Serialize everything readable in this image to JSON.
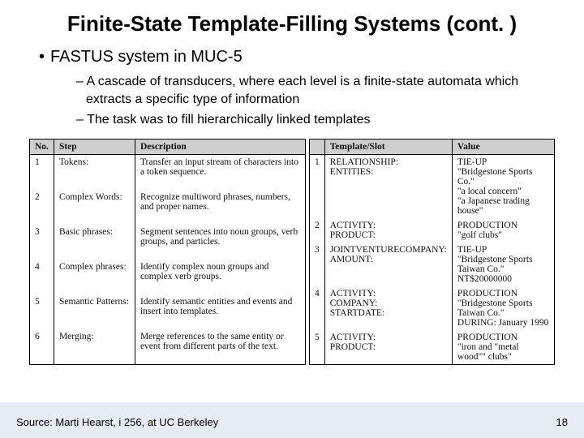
{
  "title": "Finite-State Template-Filling Systems (cont. )",
  "bullet_l1": "FASTUS system in MUC-5",
  "bullets_l2": [
    "A cascade of transducers, where each level is a finite-state automata which extracts a specific type of information",
    "The task was to fill hierarchically linked templates"
  ],
  "table_left": {
    "headers": [
      "No.",
      "Step",
      "Description"
    ],
    "rows": [
      [
        "1",
        "Tokens:",
        "Transfer an input stream of characters into a token sequence."
      ],
      [
        "2",
        "Complex Words:",
        "Recognize multiword phrases, numbers, and proper names."
      ],
      [
        "3",
        "Basic phrases:",
        "Segment sentences into noun groups, verb groups, and particles."
      ],
      [
        "4",
        "Complex phrases:",
        "Identify complex noun groups and complex verb groups."
      ],
      [
        "5",
        "Semantic Patterns:",
        "Identify semantic entities and events and insert into templates."
      ],
      [
        "6",
        "Merging:",
        "Merge references to the same entity or event from different parts of the text."
      ]
    ]
  },
  "table_right": {
    "headers": [
      "",
      "Template/Slot",
      "Value"
    ],
    "rows": [
      [
        "1",
        "RELATIONSHIP:\nENTITIES:",
        "TIE-UP\n\"Bridgestone Sports Co.\"\n\"a local concern\"\n\"a Japanese trading house\""
      ],
      [
        "2",
        "ACTIVITY:\nPRODUCT:",
        "PRODUCTION\n\"golf clubs\""
      ],
      [
        "3",
        "JOINTVENTURECOMPANY:\nAMOUNT:",
        "TIE-UP\n\"Bridgestone Sports Taiwan Co.\"\nNT$20000000"
      ],
      [
        "4",
        "ACTIVITY:\nCOMPANY:\nSTARTDATE:",
        "PRODUCTION\n\"Bridgestone Sports Taiwan Co.\"\nDURING: January 1990"
      ],
      [
        "5",
        "ACTIVITY:\nPRODUCT:",
        "PRODUCTION\n\"iron and \"metal wood\"\" clubs\""
      ]
    ]
  },
  "source": "Source: Marti Hearst, i 256, at UC Berkeley",
  "page_number": "18"
}
